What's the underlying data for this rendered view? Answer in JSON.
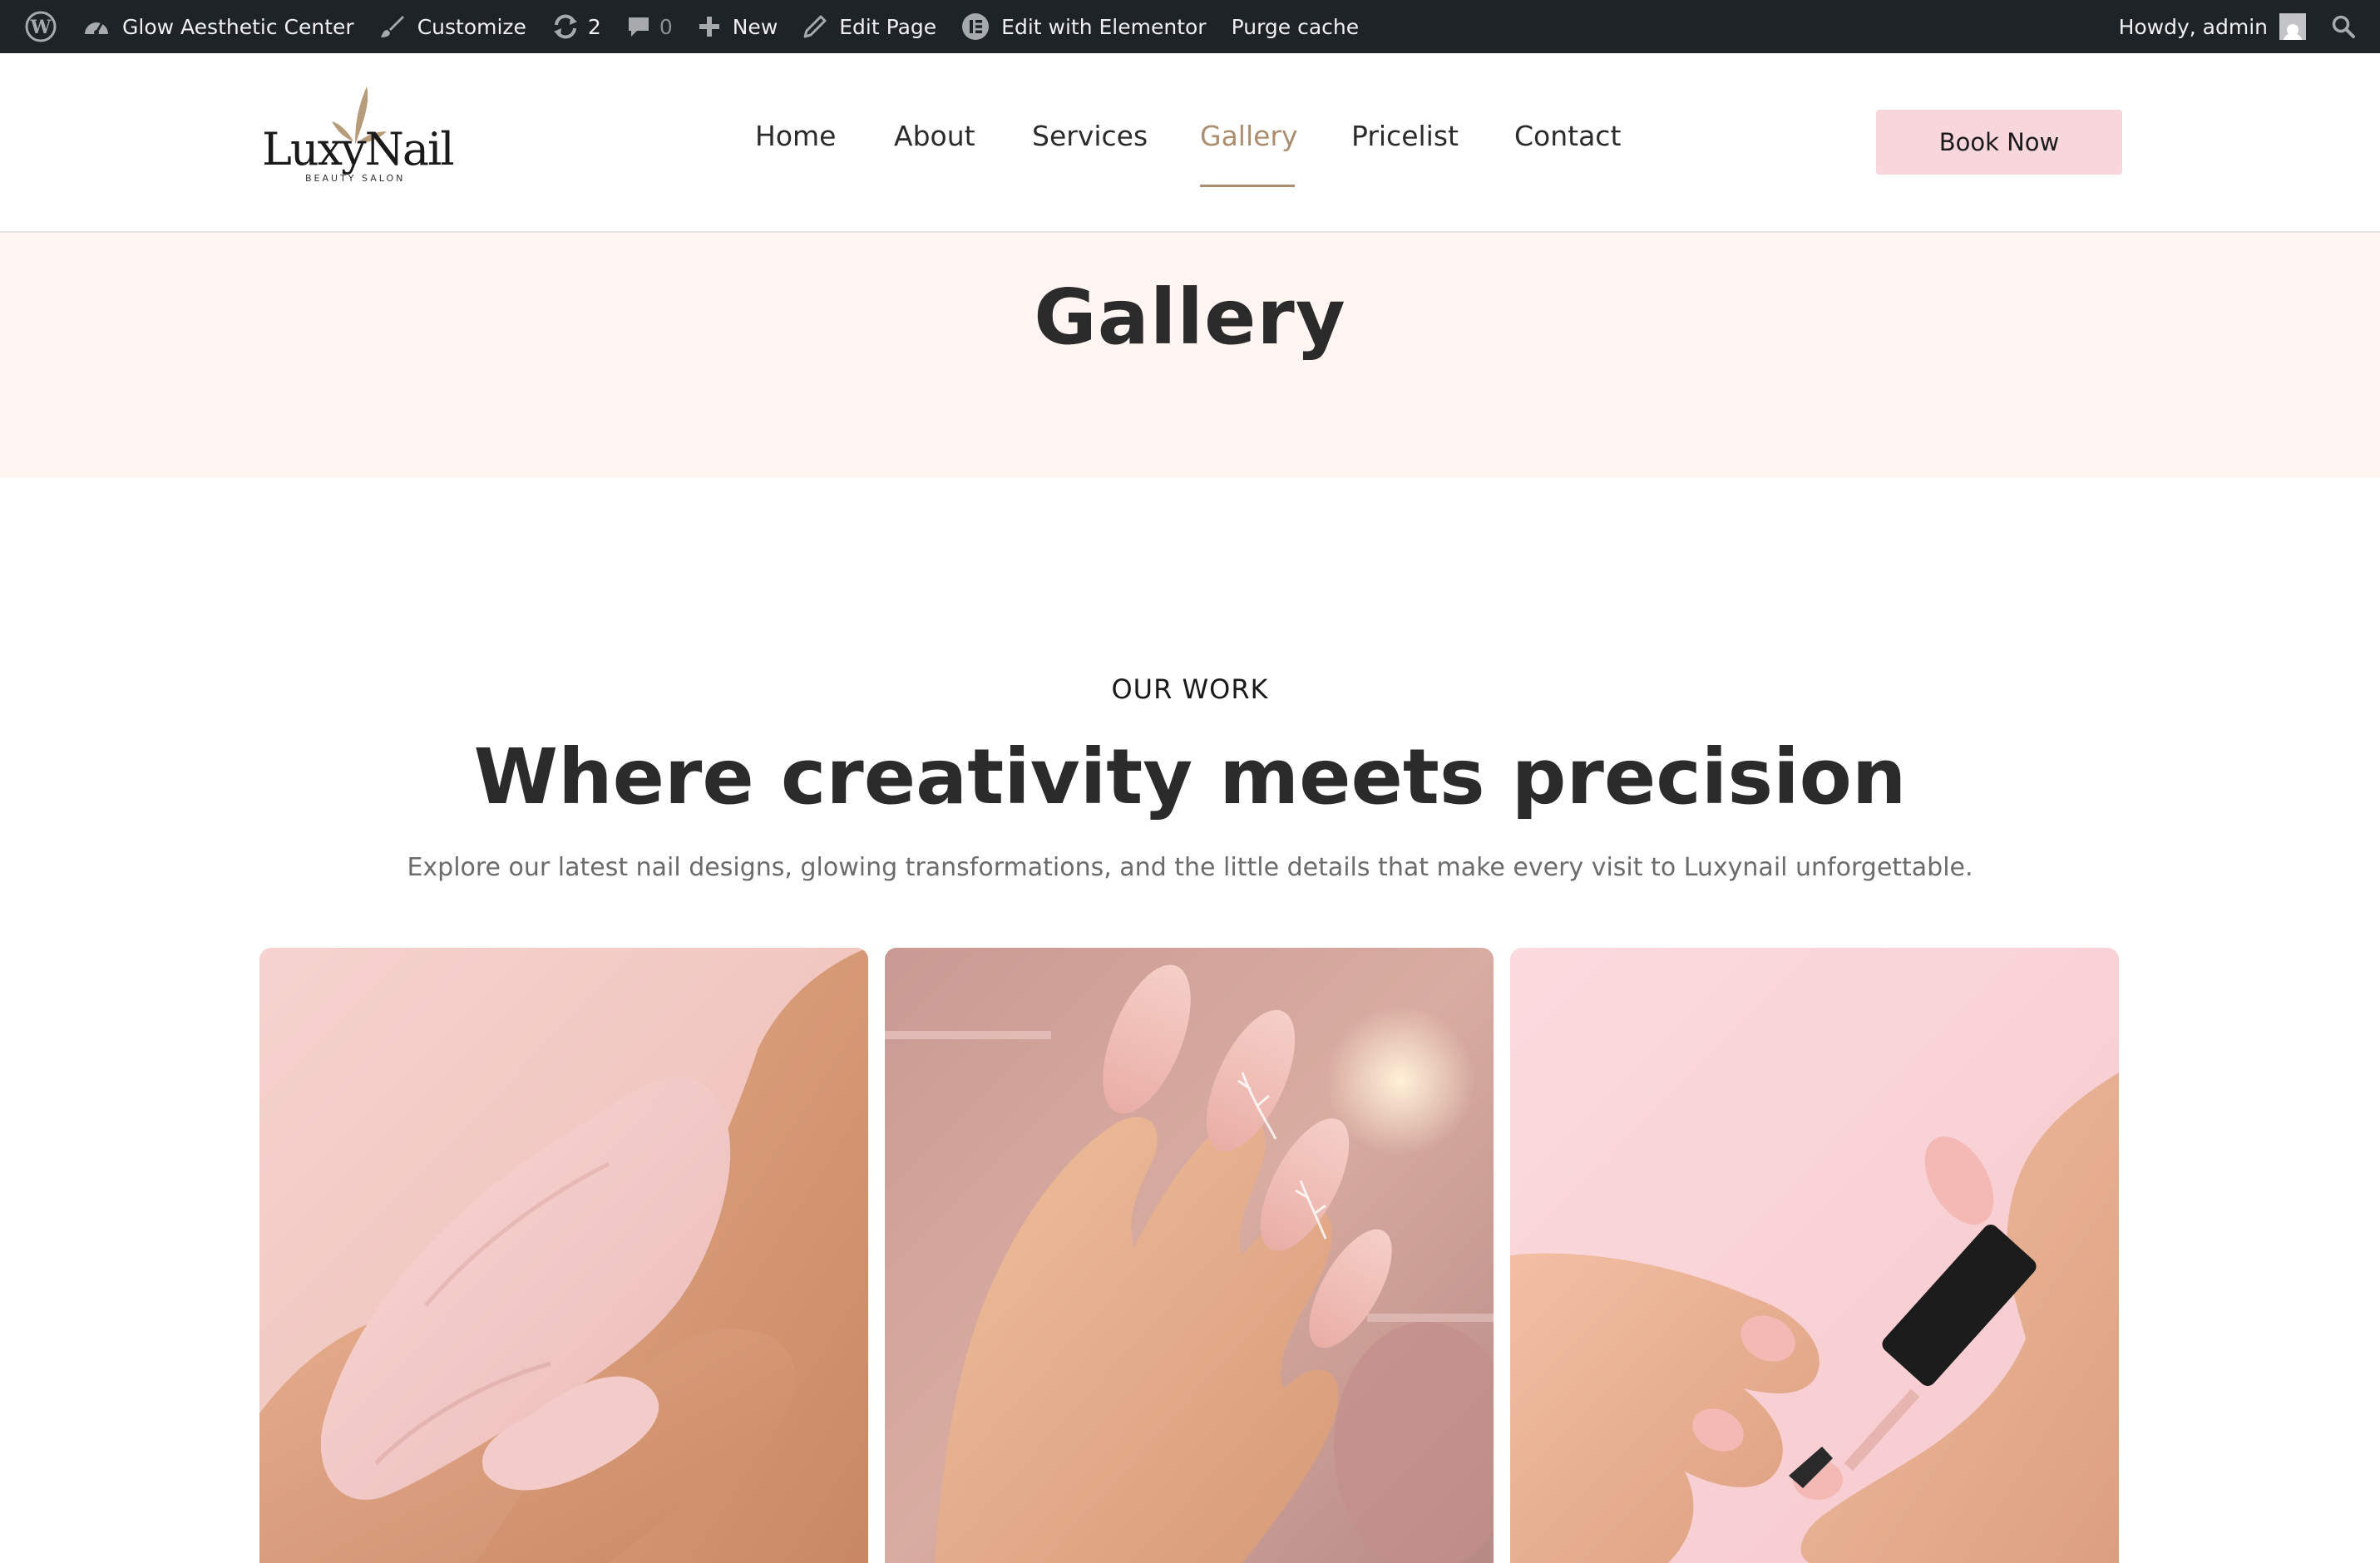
{
  "admin_bar": {
    "site_name": "Glow Aesthetic Center",
    "customize": "Customize",
    "updates_count": "2",
    "comments_count": "0",
    "new": "New",
    "edit_page": "Edit Page",
    "edit_elementor": "Edit with Elementor",
    "purge_cache": "Purge cache",
    "howdy": "Howdy, admin",
    "icons": [
      "wordpress-icon",
      "dashboard-icon",
      "brush-icon",
      "updates-icon",
      "comment-icon",
      "plus-icon",
      "pencil-icon",
      "elementor-icon",
      "avatar",
      "search-icon"
    ]
  },
  "header": {
    "logo_text": "LuxyNail",
    "logo_subtext": "BEAUTY SALON",
    "nav": [
      {
        "label": "Home"
      },
      {
        "label": "About"
      },
      {
        "label": "Services"
      },
      {
        "label": "Gallery",
        "active": true
      },
      {
        "label": "Pricelist"
      },
      {
        "label": "Contact"
      }
    ],
    "cta": "Book Now"
  },
  "page": {
    "title": "Gallery"
  },
  "intro": {
    "eyebrow": "OUR WORK",
    "heading": "Where creativity meets precision",
    "lead": "Explore our latest nail designs, glowing transformations, and the little details that make every visit to Luxynail unforgettable."
  },
  "colors": {
    "admin_bar_bg": "#1d2327",
    "accent_gold": "#a98f6f",
    "button_pink": "#f7d6dc",
    "title_band_bg": "#fff5f3",
    "heading_text": "#2b2b2b",
    "lead_text": "#6b6b6b"
  }
}
